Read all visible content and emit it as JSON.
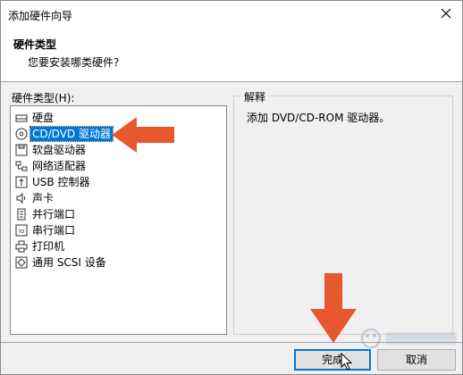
{
  "window": {
    "title": "添加硬件向导"
  },
  "header": {
    "title": "硬件类型",
    "subtitle": "您要安装哪类硬件?"
  },
  "hardware_list": {
    "label": "硬件类型(H):",
    "items": [
      {
        "label": "硬盘",
        "icon": "hard-disk-icon"
      },
      {
        "label": "CD/DVD 驱动器",
        "icon": "cd-dvd-icon",
        "selected": true
      },
      {
        "label": "软盘驱动器",
        "icon": "floppy-icon"
      },
      {
        "label": "网络适配器",
        "icon": "network-adapter-icon"
      },
      {
        "label": "USB 控制器",
        "icon": "usb-icon"
      },
      {
        "label": "声卡",
        "icon": "speaker-icon"
      },
      {
        "label": "并行端口",
        "icon": "parallel-port-icon"
      },
      {
        "label": "串行端口",
        "icon": "serial-port-icon"
      },
      {
        "label": "打印机",
        "icon": "printer-icon"
      },
      {
        "label": "通用 SCSI 设备",
        "icon": "scsi-icon"
      }
    ]
  },
  "explanation": {
    "legend": "解释",
    "text": "添加 DVD/CD-ROM 驱动器。"
  },
  "buttons": {
    "finish": "完成",
    "cancel": "取消"
  },
  "colors": {
    "selection": "#0078d7",
    "annotation_arrow": "#e8582f"
  }
}
